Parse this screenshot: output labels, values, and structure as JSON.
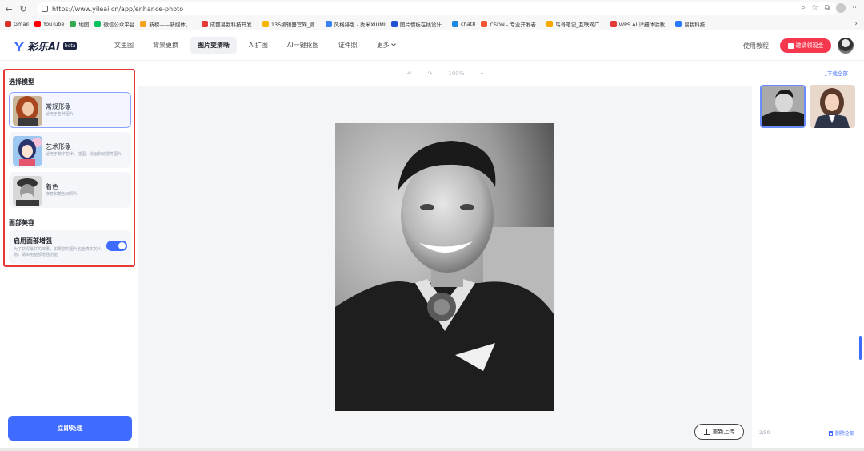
{
  "browser": {
    "url": "https://www.yileai.cn/app/enhance-photo",
    "bookmarks": [
      {
        "label": "Gmail",
        "color": "#d93025"
      },
      {
        "label": "YouTube",
        "color": "#ff0000"
      },
      {
        "label": "地图",
        "color": "#34a853"
      },
      {
        "label": "微信公众平台",
        "color": "#07c160"
      },
      {
        "label": "新榜——新媒体、...",
        "color": "#f7a21b"
      },
      {
        "label": "成都易我科技开发...",
        "color": "#e53935"
      },
      {
        "label": "135编辑器官网_微...",
        "color": "#f5b400"
      },
      {
        "label": "风格排版 - 秀米XIUMI",
        "color": "#3b82f6"
      },
      {
        "label": "图片懂板在线设计...",
        "color": "#1f4fd6"
      },
      {
        "label": "chat8",
        "color": "#1e88e5"
      },
      {
        "label": "CSDN - 专业开发者...",
        "color": "#fc5531"
      },
      {
        "label": "鸟哥笔记_互联网广...",
        "color": "#f6a800"
      },
      {
        "label": "WPS AI 详细体验教...",
        "color": "#e53935"
      },
      {
        "label": "易我科技",
        "color": "#2979ff"
      }
    ]
  },
  "header": {
    "logo_text": "彩乐AI",
    "logo_badge": "beta",
    "nav": [
      "文生图",
      "背景更换",
      "图片变清晰",
      "AI扩图",
      "AI一键抠图",
      "证件照",
      "更多"
    ],
    "active_nav": "图片变清晰",
    "tutorial": "使用教程",
    "invite": "邀请领现金",
    "colors": {
      "primary": "#3f6cff",
      "invite": "#f5384e"
    }
  },
  "left": {
    "model_title": "选择模型",
    "models": [
      {
        "name": "常规形象",
        "desc": "适用于各种图片"
      },
      {
        "name": "艺术形象",
        "desc": "适用于数字艺术、插图、绘画和动漫等图片"
      },
      {
        "name": "着色",
        "desc": "修复和着色旧照片"
      }
    ],
    "selected_model": "常规形象",
    "face_title": "面部美容",
    "face_toggle_label": "启用面部增强",
    "face_toggle_desc": "为了获得最好的效果，如果您的图片包含真实的人物，请启用面部增强功能",
    "face_toggle_on": true,
    "process_button": "立即处理"
  },
  "center": {
    "toolbar": {
      "undo": "↶",
      "redo": "↷",
      "zoom": "100%",
      "locate": "⌖"
    },
    "reupload": "重新上传"
  },
  "right": {
    "download_all": "下载全部",
    "count": "2/50",
    "delete_all": "删除全部"
  }
}
